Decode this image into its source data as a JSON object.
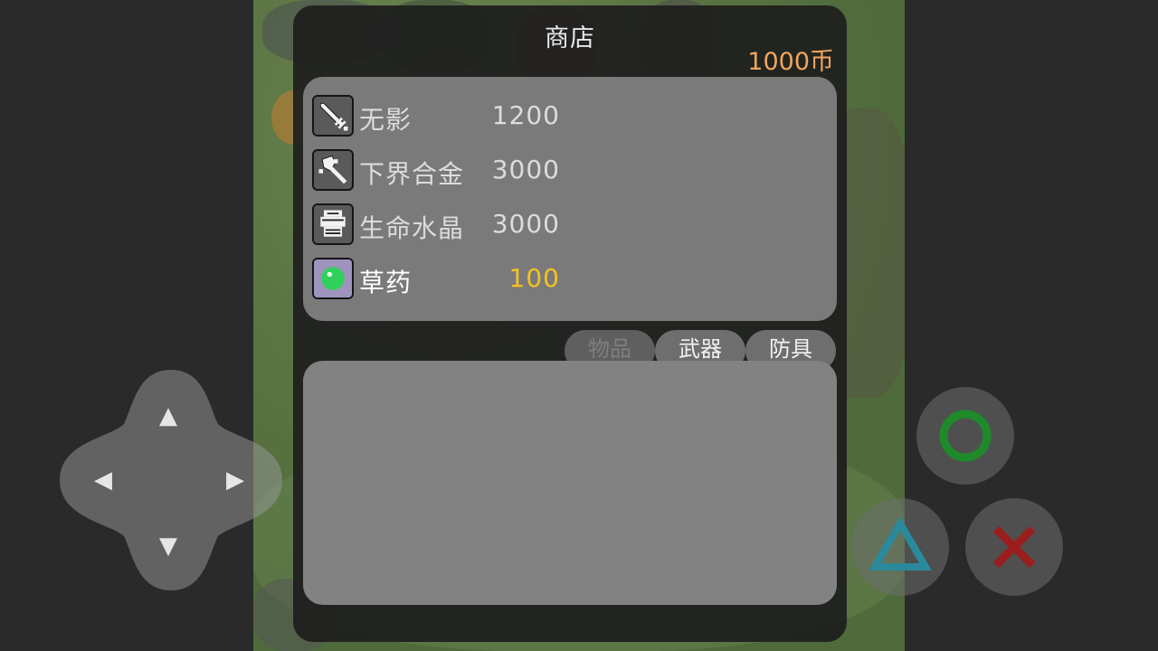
{
  "shop": {
    "title": "商店",
    "coins": "1000币"
  },
  "items": [
    {
      "name": "无影",
      "price": "1200",
      "icon": "sword-icon"
    },
    {
      "name": "下界合金",
      "price": "3000",
      "icon": "axe-icon"
    },
    {
      "name": "生命水晶",
      "price": "3000",
      "icon": "armor-icon"
    },
    {
      "name": "草药",
      "price": "100",
      "icon": "green-orb-icon",
      "selected": true
    }
  ],
  "tabs": [
    {
      "label": "物品",
      "enabled": false
    },
    {
      "label": "武器",
      "enabled": true
    },
    {
      "label": "防具",
      "enabled": true
    }
  ],
  "controls": {
    "dpad_up": "▲",
    "dpad_down": "▼",
    "dpad_left": "◀",
    "dpad_right": "▶",
    "circle_color": "#1f8a2a",
    "triangle_color": "#2a8a9c",
    "cross_color": "#9a1e1e"
  },
  "colors": {
    "coins": "#f0a560",
    "selected_price": "#f4c21f"
  }
}
